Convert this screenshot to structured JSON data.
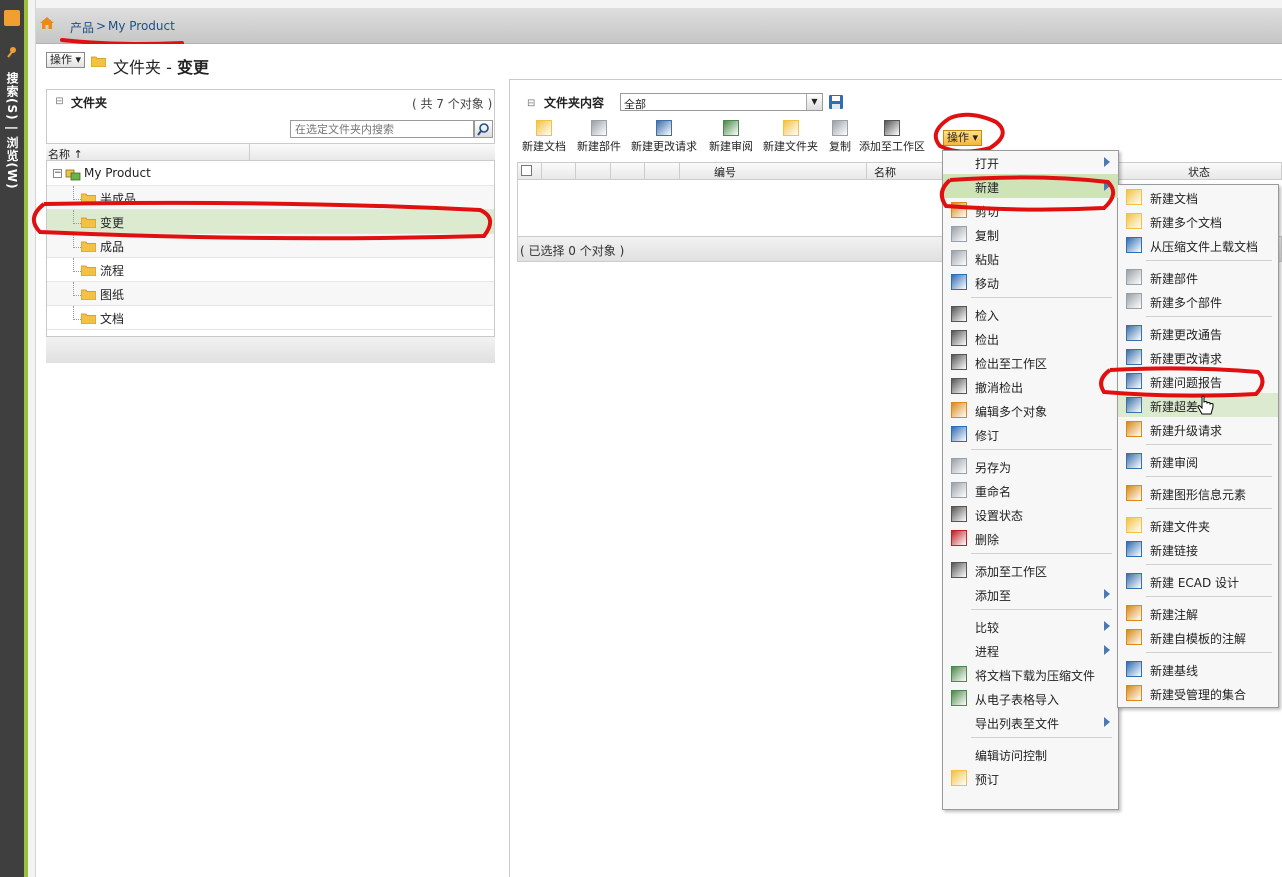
{
  "sidebar": {
    "vertical_text": "搜索(S) | 浏览(W)"
  },
  "breadcrumb": {
    "product": "产品",
    "separator": ">",
    "my_product": "My Product"
  },
  "title_bar": {
    "actions_label": "操作",
    "title_prefix": "文件夹 - ",
    "title_bold": "变更"
  },
  "folder_panel": {
    "collapse_symbol": "⊟",
    "title": "文件夹",
    "count": "( 共 7 个对象 )",
    "search_placeholder": "在选定文件夹内搜索",
    "column_name": "名称 ↑",
    "tree": [
      {
        "label": "My Product",
        "level": 0,
        "selected": false
      },
      {
        "label": "半成品",
        "level": 1,
        "selected": false
      },
      {
        "label": "变更",
        "level": 1,
        "selected": true
      },
      {
        "label": "成品",
        "level": 1,
        "selected": false
      },
      {
        "label": "流程",
        "level": 1,
        "selected": false
      },
      {
        "label": "图纸",
        "level": 1,
        "selected": false
      },
      {
        "label": "文档",
        "level": 1,
        "selected": false
      }
    ]
  },
  "contents_panel": {
    "collapse_symbol": "⊟",
    "title": "文件夹内容",
    "filter_value": "全部",
    "toolbar": [
      {
        "label": "新建文档",
        "icon": "new-document-icon"
      },
      {
        "label": "新建部件",
        "icon": "new-part-icon"
      },
      {
        "label": "新建更改请求",
        "icon": "change-request-icon"
      },
      {
        "label": "新建审阅",
        "icon": "review-icon"
      },
      {
        "label": "新建文件夹",
        "icon": "new-folder-icon"
      },
      {
        "label": "复制",
        "icon": "copy-icon"
      },
      {
        "label": "添加至工作区",
        "icon": "add-to-workspace-icon"
      }
    ],
    "actions_label": "操作",
    "columns": {
      "number": "编号",
      "name": "名称",
      "status": "状态"
    },
    "selected_text": "( 已选择 0 个对象 )"
  },
  "actions_menu": {
    "items": [
      {
        "label": "打开",
        "submenu": true
      },
      {
        "label": "新建",
        "submenu": true
      },
      {
        "label": "剪切"
      },
      {
        "label": "复制"
      },
      {
        "label": "粘贴"
      },
      {
        "label": "移动"
      },
      {
        "label": "检入"
      },
      {
        "label": "检出"
      },
      {
        "label": "检出至工作区"
      },
      {
        "label": "撤消检出"
      },
      {
        "label": "编辑多个对象"
      },
      {
        "label": "修订"
      },
      {
        "label": "另存为"
      },
      {
        "label": "重命名"
      },
      {
        "label": "设置状态"
      },
      {
        "label": "删除"
      },
      {
        "label": "添加至工作区"
      },
      {
        "label": "添加至",
        "submenu": true
      },
      {
        "label": "比较",
        "submenu": true
      },
      {
        "label": "进程",
        "submenu": true
      },
      {
        "label": "将文档下载为压缩文件"
      },
      {
        "label": "从电子表格导入"
      },
      {
        "label": "导出列表至文件",
        "submenu": true
      },
      {
        "label": "编辑访问控制"
      },
      {
        "label": "预订"
      }
    ]
  },
  "new_submenu": {
    "items": [
      {
        "label": "新建文档"
      },
      {
        "label": "新建多个文档"
      },
      {
        "label": "从压缩文件上载文档"
      },
      {
        "label": "新建部件"
      },
      {
        "label": "新建多个部件"
      },
      {
        "label": "新建更改通告"
      },
      {
        "label": "新建更改请求"
      },
      {
        "label": "新建问题报告"
      },
      {
        "label": "新建超差"
      },
      {
        "label": "新建升级请求"
      },
      {
        "label": "新建审阅"
      },
      {
        "label": "新建图形信息元素"
      },
      {
        "label": "新建文件夹"
      },
      {
        "label": "新建链接"
      },
      {
        "label": "新建 ECAD 设计"
      },
      {
        "label": "新建注解"
      },
      {
        "label": "新建自模板的注解"
      },
      {
        "label": "新建基线"
      },
      {
        "label": "新建受管理的集合"
      }
    ]
  },
  "colors": {
    "accent_green": "#9bc13c",
    "selected_row": "#dcebd0",
    "annotation_red": "#e11010",
    "link_blue": "#1f4f86"
  }
}
